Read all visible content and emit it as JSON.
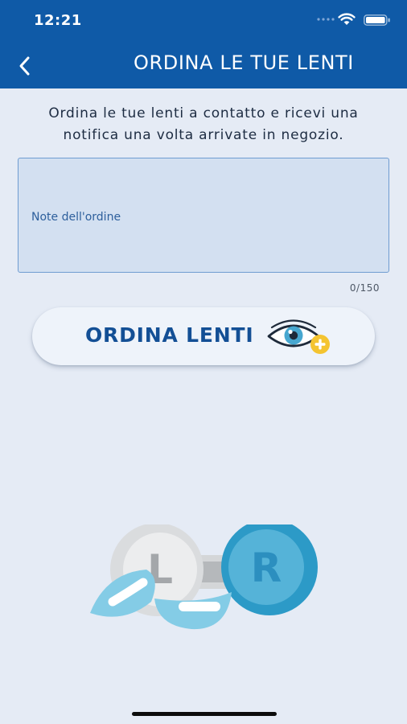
{
  "status_bar": {
    "time": "12:21"
  },
  "header": {
    "back_icon": "chevron-left-icon",
    "title": "ORDINA LE TUE LENTI"
  },
  "intro": {
    "line1": "Ordina le tue lenti a contatto e ricevi una",
    "line2": "notifica una volta arrivate in negozio."
  },
  "notes": {
    "value": "",
    "placeholder": "Note dell'ordine",
    "counter": "0/150"
  },
  "order_button": {
    "label": "ORDINA LENTI",
    "icon": "eye-plus-icon"
  },
  "illustration": {
    "left_label": "L",
    "right_label": "R",
    "icon": "contact-lens-case-icon"
  },
  "colors": {
    "header_bg": "#0f5aa7",
    "page_bg": "#e5ebf5",
    "accent": "#134f95",
    "lens_blue": "#4aaccf",
    "plus_yellow": "#f4c430"
  }
}
